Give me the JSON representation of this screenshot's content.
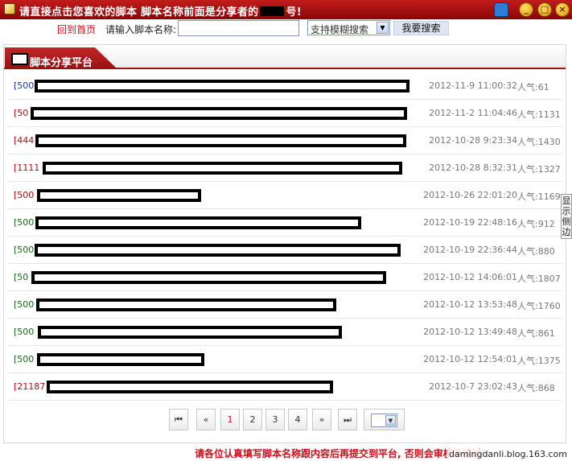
{
  "window": {
    "title_part1": "请直接点击您喜欢的脚本 脚本名称前面是分享者的",
    "title_part2": "号!",
    "buttons": [
      "?",
      "_",
      "□",
      "×"
    ]
  },
  "toolbar": {
    "home_link": "回到首页",
    "name_label": "请输入脚本名称:",
    "name_value": "",
    "search_mode": "支持模糊搜索",
    "search_button": "我要搜索"
  },
  "section": {
    "title": "脚本分享平台"
  },
  "rows": [
    {
      "id": "[500",
      "date": "2012-11-9 11:00:32",
      "popularity": "人气:61",
      "id_color": "#1a3a9a"
    },
    {
      "id": "[50",
      "date": "2012-11-2 11:04:46",
      "popularity": "人气:1131",
      "id_color": "#a81010"
    },
    {
      "id": "[444",
      "date": "2012-10-28 9:23:34",
      "popularity": "人气:1430",
      "id_color": "#a81010"
    },
    {
      "id": "[1111",
      "date": "2012-10-28 8:32:31",
      "popularity": "人气:1327",
      "id_color": "#a81010"
    },
    {
      "id": "[500",
      "date": "2012-10-26 22:01:20",
      "popularity": "人气:1169",
      "id_color": "#a81010"
    },
    {
      "id": "[500",
      "date": "2012-10-19 22:48:16",
      "popularity": "人气:912",
      "id_color": "#1a6a1a"
    },
    {
      "id": "[500",
      "date": "2012-10-19 22:36:44",
      "popularity": "人气:880",
      "id_color": "#1a6a1a"
    },
    {
      "id": "[50",
      "date": "2012-10-12 14:06:01",
      "popularity": "人气:1807",
      "id_color": "#1a6a1a"
    },
    {
      "id": "[500",
      "date": "2012-10-12 13:53:48",
      "popularity": "人气:1760",
      "id_color": "#1a6a1a"
    },
    {
      "id": "[500",
      "date": "2012-10-12 13:49:48",
      "popularity": "人气:861",
      "id_color": "#1a6a1a"
    },
    {
      "id": "[500",
      "date": "2012-10-12 12:54:01",
      "popularity": "人气:1375",
      "id_color": "#1a6a1a"
    },
    {
      "id": "[21187",
      "date": "2012-10-7 23:02:43",
      "popularity": "人气:868",
      "id_color": "#a81010"
    }
  ],
  "pager": {
    "first": "⏮",
    "prev": "«",
    "pages": [
      "1",
      "2",
      "3",
      "4"
    ],
    "current": "1",
    "next": "»",
    "last": "⏭"
  },
  "side_tab": "显示侧边",
  "footer": {
    "note": "请各位认真填写脚本名称跟内容后再提交到平台, 否则会审核不通过!",
    "watermark": "damingdanli.blog.163.com"
  }
}
